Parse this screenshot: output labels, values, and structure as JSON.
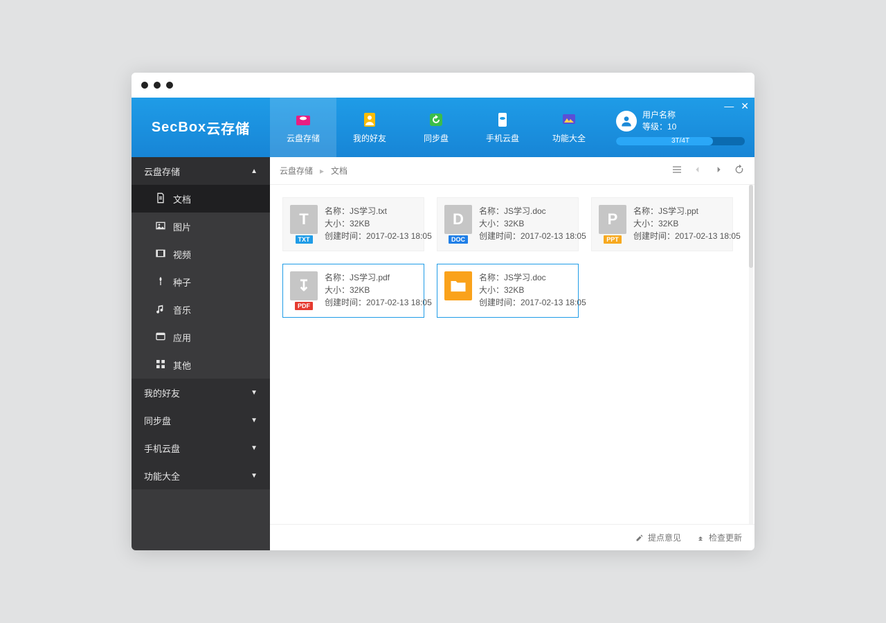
{
  "brand": {
    "left": "SecBox",
    "right": "云存储"
  },
  "nav": [
    {
      "label": "云盘存储",
      "active": true
    },
    {
      "label": "我的好友",
      "active": false
    },
    {
      "label": "同步盘",
      "active": false
    },
    {
      "label": "手机云盘",
      "active": false
    },
    {
      "label": "功能大全",
      "active": false
    }
  ],
  "user": {
    "name": "用户名称",
    "level_label": "等级：10",
    "storage_label": "3T/4T",
    "storage_pct": 75
  },
  "win": {
    "minimize": "—",
    "close": "✕"
  },
  "sidebar": {
    "groups": [
      {
        "label": "云盘存储",
        "expanded": true,
        "items": [
          {
            "label": "文档",
            "icon": "document",
            "active": true
          },
          {
            "label": "图片",
            "icon": "image",
            "active": false
          },
          {
            "label": "视频",
            "icon": "video",
            "active": false
          },
          {
            "label": "种子",
            "icon": "seed",
            "active": false
          },
          {
            "label": "音乐",
            "icon": "music",
            "active": false
          },
          {
            "label": "应用",
            "icon": "app",
            "active": false
          },
          {
            "label": "其他",
            "icon": "other",
            "active": false
          }
        ]
      },
      {
        "label": "我的好友",
        "expanded": false
      },
      {
        "label": "同步盘",
        "expanded": false
      },
      {
        "label": "手机云盘",
        "expanded": false
      },
      {
        "label": "功能大全",
        "expanded": false
      }
    ]
  },
  "breadcrumb": [
    "云盘存储",
    "文档"
  ],
  "labels": {
    "name": "名称：",
    "size": "大小：",
    "created": "创建时间："
  },
  "files": [
    {
      "name": "JS学习.txt",
      "size": "32KB",
      "created": "2017-02-13 18:05",
      "glyph": "T",
      "tag": "TXT",
      "tag_color": "#1f9ce7",
      "selected": false
    },
    {
      "name": "JS学习.doc",
      "size": "32KB",
      "created": "2017-02-13 18:05",
      "glyph": "D",
      "tag": "DOC",
      "tag_color": "#1f7fe7",
      "selected": false
    },
    {
      "name": "JS学习.ppt",
      "size": "32KB",
      "created": "2017-02-13 18:05",
      "glyph": "P",
      "tag": "PPT",
      "tag_color": "#f7a91f",
      "selected": false
    },
    {
      "name": "JS学习.pdf",
      "size": "32KB",
      "created": "2017-02-13 18:05",
      "glyph": "↧",
      "tag": "PDF",
      "tag_color": "#e53a2f",
      "selected": true
    },
    {
      "name": "JS学习.doc",
      "size": "32KB",
      "created": "2017-02-13 18:05",
      "glyph": "folder",
      "tag": "",
      "tag_color": "",
      "selected": true
    }
  ],
  "footer": {
    "feedback": "提点意见",
    "update": "检查更新"
  }
}
